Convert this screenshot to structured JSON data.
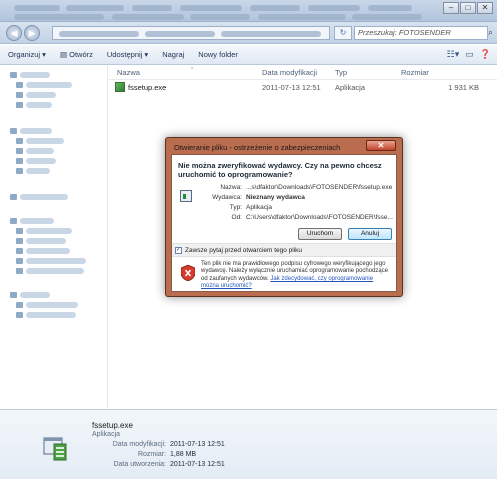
{
  "window": {
    "search_placeholder": "Przeszukaj: FOTOSENDER",
    "controls": {
      "minimize": "–",
      "maximize": "□",
      "close": "✕"
    }
  },
  "toolbar": {
    "organize": "Organizuj ▾",
    "open": "Otwórz",
    "share": "Udostępnij ▾",
    "burn": "Nagraj",
    "new_folder": "Nowy folder"
  },
  "columns": {
    "name": "Nazwa",
    "modified": "Data modyfikacji",
    "type": "Typ",
    "size": "Rozmiar"
  },
  "files": [
    {
      "name": "fssetup.exe",
      "modified": "2011-07-13 12:51",
      "type": "Aplikacja",
      "size": "1 931 KB"
    }
  ],
  "dialog": {
    "title": "Otwieranie pliku - ostrzeżenie o zabezpieczeniach",
    "close": "✕",
    "heading": "Nie można zweryfikować wydawcy. Czy na pewno chcesz uruchomić to oprogramowanie?",
    "fields": [
      {
        "label": "Nazwa:",
        "value": "...s\\dfaktor\\Downloads\\FOTOSENDER\\fssetup.exe"
      },
      {
        "label": "Wydawca:",
        "value": "Nieznany wydawca"
      },
      {
        "label": "Typ:",
        "value": "Aplikacja"
      },
      {
        "label": "Od:",
        "value": "C:\\Users\\dfaktor\\Downloads\\FOTOSENDER\\fsse..."
      }
    ],
    "run_button": "Uruchom",
    "cancel_button": "Anuluj",
    "checkbox_label": "Zawsze pytaj przed otwarciem tego pliku",
    "warning_text": "Ten plik nie ma prawidłowego podpisu cyfrowego weryfikującego jego wydawcę. Należy wyłącznie uruchamiać oprogramowanie pochodzące od zaufanych wydawców.",
    "warning_link": "Jak zdecydować, czy oprogramowanie można uruchomić?"
  },
  "details": {
    "name": "fssetup.exe",
    "type": "Aplikacja",
    "modified_label": "Data modyfikacji:",
    "modified_value": "2011-07-13 12:51",
    "size_label": "Rozmiar:",
    "size_value": "1,88 MB",
    "created_label": "Data utworzenia:",
    "created_value": "2011-07-13 12:51"
  }
}
